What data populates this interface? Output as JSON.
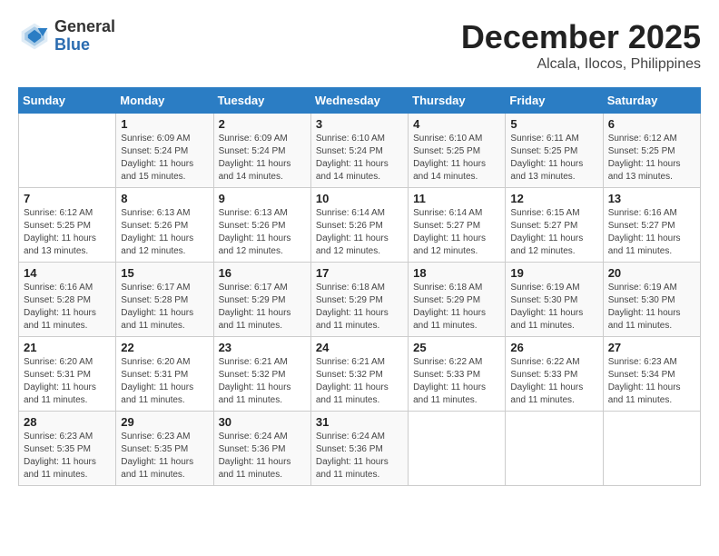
{
  "header": {
    "logo": {
      "general": "General",
      "blue": "Blue"
    },
    "title": "December 2025",
    "subtitle": "Alcala, Ilocos, Philippines"
  },
  "calendar": {
    "headers": [
      "Sunday",
      "Monday",
      "Tuesday",
      "Wednesday",
      "Thursday",
      "Friday",
      "Saturday"
    ],
    "weeks": [
      [
        {
          "day": "",
          "sunrise": "",
          "sunset": "",
          "daylight": ""
        },
        {
          "day": "1",
          "sunrise": "Sunrise: 6:09 AM",
          "sunset": "Sunset: 5:24 PM",
          "daylight": "Daylight: 11 hours and 15 minutes."
        },
        {
          "day": "2",
          "sunrise": "Sunrise: 6:09 AM",
          "sunset": "Sunset: 5:24 PM",
          "daylight": "Daylight: 11 hours and 14 minutes."
        },
        {
          "day": "3",
          "sunrise": "Sunrise: 6:10 AM",
          "sunset": "Sunset: 5:24 PM",
          "daylight": "Daylight: 11 hours and 14 minutes."
        },
        {
          "day": "4",
          "sunrise": "Sunrise: 6:10 AM",
          "sunset": "Sunset: 5:25 PM",
          "daylight": "Daylight: 11 hours and 14 minutes."
        },
        {
          "day": "5",
          "sunrise": "Sunrise: 6:11 AM",
          "sunset": "Sunset: 5:25 PM",
          "daylight": "Daylight: 11 hours and 13 minutes."
        },
        {
          "day": "6",
          "sunrise": "Sunrise: 6:12 AM",
          "sunset": "Sunset: 5:25 PM",
          "daylight": "Daylight: 11 hours and 13 minutes."
        }
      ],
      [
        {
          "day": "7",
          "sunrise": "Sunrise: 6:12 AM",
          "sunset": "Sunset: 5:25 PM",
          "daylight": "Daylight: 11 hours and 13 minutes."
        },
        {
          "day": "8",
          "sunrise": "Sunrise: 6:13 AM",
          "sunset": "Sunset: 5:26 PM",
          "daylight": "Daylight: 11 hours and 12 minutes."
        },
        {
          "day": "9",
          "sunrise": "Sunrise: 6:13 AM",
          "sunset": "Sunset: 5:26 PM",
          "daylight": "Daylight: 11 hours and 12 minutes."
        },
        {
          "day": "10",
          "sunrise": "Sunrise: 6:14 AM",
          "sunset": "Sunset: 5:26 PM",
          "daylight": "Daylight: 11 hours and 12 minutes."
        },
        {
          "day": "11",
          "sunrise": "Sunrise: 6:14 AM",
          "sunset": "Sunset: 5:27 PM",
          "daylight": "Daylight: 11 hours and 12 minutes."
        },
        {
          "day": "12",
          "sunrise": "Sunrise: 6:15 AM",
          "sunset": "Sunset: 5:27 PM",
          "daylight": "Daylight: 11 hours and 12 minutes."
        },
        {
          "day": "13",
          "sunrise": "Sunrise: 6:16 AM",
          "sunset": "Sunset: 5:27 PM",
          "daylight": "Daylight: 11 hours and 11 minutes."
        }
      ],
      [
        {
          "day": "14",
          "sunrise": "Sunrise: 6:16 AM",
          "sunset": "Sunset: 5:28 PM",
          "daylight": "Daylight: 11 hours and 11 minutes."
        },
        {
          "day": "15",
          "sunrise": "Sunrise: 6:17 AM",
          "sunset": "Sunset: 5:28 PM",
          "daylight": "Daylight: 11 hours and 11 minutes."
        },
        {
          "day": "16",
          "sunrise": "Sunrise: 6:17 AM",
          "sunset": "Sunset: 5:29 PM",
          "daylight": "Daylight: 11 hours and 11 minutes."
        },
        {
          "day": "17",
          "sunrise": "Sunrise: 6:18 AM",
          "sunset": "Sunset: 5:29 PM",
          "daylight": "Daylight: 11 hours and 11 minutes."
        },
        {
          "day": "18",
          "sunrise": "Sunrise: 6:18 AM",
          "sunset": "Sunset: 5:29 PM",
          "daylight": "Daylight: 11 hours and 11 minutes."
        },
        {
          "day": "19",
          "sunrise": "Sunrise: 6:19 AM",
          "sunset": "Sunset: 5:30 PM",
          "daylight": "Daylight: 11 hours and 11 minutes."
        },
        {
          "day": "20",
          "sunrise": "Sunrise: 6:19 AM",
          "sunset": "Sunset: 5:30 PM",
          "daylight": "Daylight: 11 hours and 11 minutes."
        }
      ],
      [
        {
          "day": "21",
          "sunrise": "Sunrise: 6:20 AM",
          "sunset": "Sunset: 5:31 PM",
          "daylight": "Daylight: 11 hours and 11 minutes."
        },
        {
          "day": "22",
          "sunrise": "Sunrise: 6:20 AM",
          "sunset": "Sunset: 5:31 PM",
          "daylight": "Daylight: 11 hours and 11 minutes."
        },
        {
          "day": "23",
          "sunrise": "Sunrise: 6:21 AM",
          "sunset": "Sunset: 5:32 PM",
          "daylight": "Daylight: 11 hours and 11 minutes."
        },
        {
          "day": "24",
          "sunrise": "Sunrise: 6:21 AM",
          "sunset": "Sunset: 5:32 PM",
          "daylight": "Daylight: 11 hours and 11 minutes."
        },
        {
          "day": "25",
          "sunrise": "Sunrise: 6:22 AM",
          "sunset": "Sunset: 5:33 PM",
          "daylight": "Daylight: 11 hours and 11 minutes."
        },
        {
          "day": "26",
          "sunrise": "Sunrise: 6:22 AM",
          "sunset": "Sunset: 5:33 PM",
          "daylight": "Daylight: 11 hours and 11 minutes."
        },
        {
          "day": "27",
          "sunrise": "Sunrise: 6:23 AM",
          "sunset": "Sunset: 5:34 PM",
          "daylight": "Daylight: 11 hours and 11 minutes."
        }
      ],
      [
        {
          "day": "28",
          "sunrise": "Sunrise: 6:23 AM",
          "sunset": "Sunset: 5:35 PM",
          "daylight": "Daylight: 11 hours and 11 minutes."
        },
        {
          "day": "29",
          "sunrise": "Sunrise: 6:23 AM",
          "sunset": "Sunset: 5:35 PM",
          "daylight": "Daylight: 11 hours and 11 minutes."
        },
        {
          "day": "30",
          "sunrise": "Sunrise: 6:24 AM",
          "sunset": "Sunset: 5:36 PM",
          "daylight": "Daylight: 11 hours and 11 minutes."
        },
        {
          "day": "31",
          "sunrise": "Sunrise: 6:24 AM",
          "sunset": "Sunset: 5:36 PM",
          "daylight": "Daylight: 11 hours and 11 minutes."
        },
        {
          "day": "",
          "sunrise": "",
          "sunset": "",
          "daylight": ""
        },
        {
          "day": "",
          "sunrise": "",
          "sunset": "",
          "daylight": ""
        },
        {
          "day": "",
          "sunrise": "",
          "sunset": "",
          "daylight": ""
        }
      ]
    ]
  }
}
